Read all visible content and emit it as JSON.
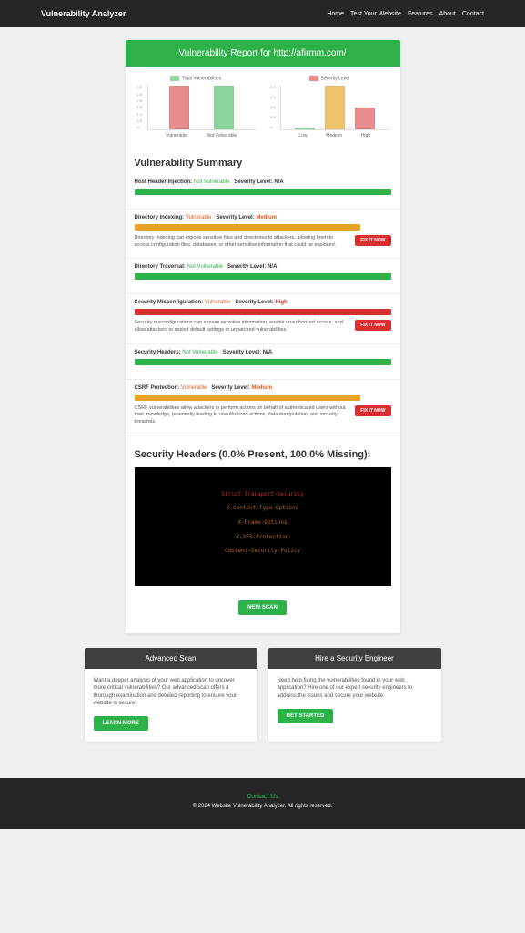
{
  "brand": "Vulnerability Analyzer",
  "nav": [
    "Home",
    "Test Your Website",
    "Features",
    "About",
    "Contact"
  ],
  "report_title": "Vulnerability Report for http://afirmm.com/",
  "chart_data": [
    {
      "type": "bar",
      "title": "Total Vulnerabilities",
      "categories": [
        "Vulnerable",
        "Not Vulnerable"
      ],
      "values": [
        3,
        3
      ],
      "colors": [
        "#e88d8d",
        "#8fd69d"
      ],
      "ylim": [
        0,
        3
      ],
      "yticks": [
        "3.0",
        "2.5",
        "2.0",
        "1.5",
        "1.0",
        "0.5",
        "0"
      ]
    },
    {
      "type": "bar",
      "title": "Severity Level",
      "categories": [
        "Low",
        "Medium",
        "High"
      ],
      "values": [
        0,
        2,
        1
      ],
      "colors": [
        "#8fd69d",
        "#f0c36d",
        "#e88d8d"
      ],
      "ylim": [
        0,
        2
      ],
      "yticks": [
        "2.0",
        "1.5",
        "1.0",
        "0.5",
        "0"
      ]
    }
  ],
  "summary_title": "Vulnerability Summary",
  "labels": {
    "severity": "Severity Level:",
    "fix": "FIX IT NOW"
  },
  "vulns": [
    {
      "name": "Host Header Injection:",
      "status": "Not Vulnerable",
      "status_class": "status-nv",
      "severity": "N/A",
      "sev_class": "sev-na",
      "bar": "bg-green",
      "desc": "",
      "fix": false
    },
    {
      "name": "Directory Indexing:",
      "status": "Vulnerable",
      "status_class": "status-v",
      "severity": "Medium",
      "sev_class": "sev-med",
      "bar": "bg-orange",
      "desc": "Directory Indexing can expose sensitive files and directories to attackers, allowing them to access configuration files, databases, or other sensitive information that could be exploited.",
      "fix": true
    },
    {
      "name": "Directory Traversal:",
      "status": "Not Vulnerable",
      "status_class": "status-nv",
      "severity": "N/A",
      "sev_class": "sev-na",
      "bar": "bg-green",
      "desc": "",
      "fix": false
    },
    {
      "name": "Security Misconfiguration:",
      "status": "Vulnerable",
      "status_class": "status-v",
      "severity": "High",
      "sev_class": "sev-high",
      "bar": "bg-red",
      "desc": "Security misconfigurations can expose sensitive information, enable unauthorized access, and allow attackers to exploit default settings or unpatched vulnerabilities.",
      "fix": true
    },
    {
      "name": "Security Headers:",
      "status": "Not Vulnerable",
      "status_class": "status-nv",
      "severity": "N/A",
      "sev_class": "sev-na",
      "bar": "bg-green",
      "desc": "",
      "fix": false
    },
    {
      "name": "CSRF Protection:",
      "status": "Vulnerable",
      "status_class": "status-v",
      "severity": "Medium",
      "sev_class": "sev-med",
      "bar": "bg-orange",
      "desc": "CSRF vulnerabilities allow attackers to perform actions on behalf of authenticated users without their knowledge, potentially leading to unauthorized actions, data manipulation, and security breaches.",
      "fix": true
    }
  ],
  "sec_headers_title": "Security Headers (0.0% Present, 100.0% Missing):",
  "terminal": [
    {
      "text": "Strict-Transport-Security",
      "cls": "t-red"
    },
    {
      "text": "X-Content-Type-Options",
      "cls": "t-brown"
    },
    {
      "text": "X-Frame-Options",
      "cls": "t-brown"
    },
    {
      "text": "X-XSS-Protection",
      "cls": "t-brown"
    },
    {
      "text": "Content-Security-Policy",
      "cls": "t-brown"
    }
  ],
  "new_scan": "NEW SCAN",
  "promo": [
    {
      "title": "Advanced Scan",
      "text": "Want a deeper analysis of your web application to uncover more critical vulnerabilities? Our advanced scan offers a thorough examination and detailed reporting to ensure your website is secure.",
      "btn": "LEARN MORE"
    },
    {
      "title": "Hire a Security Engineer",
      "text": "Need help fixing the vulnerabilities found in your web application? Hire one of our expert security engineers to address the issues and secure your website.",
      "btn": "GET STARTED"
    }
  ],
  "footer_link": "Contact Us",
  "footer_copy": "© 2024 Website Vulnerability Analyzer. All rights reserved."
}
